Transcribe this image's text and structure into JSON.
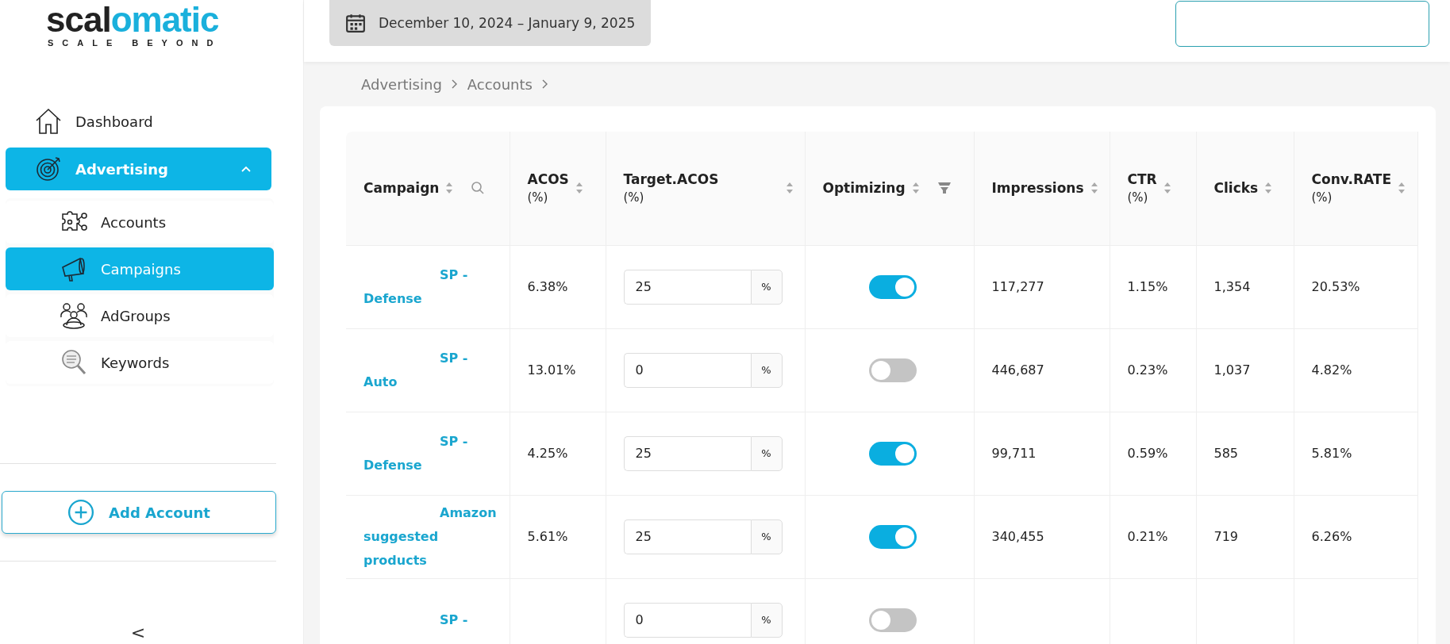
{
  "logo": {
    "dark": "scal",
    "accent": "omatic",
    "tagline": "SCALE BEYOND"
  },
  "sidebar": {
    "items": [
      {
        "label": "Dashboard",
        "selected": false
      },
      {
        "label": "Advertising",
        "selected": true,
        "expanded": true,
        "children": [
          {
            "label": "Accounts",
            "selected": false
          },
          {
            "label": "Campaigns",
            "selected": true
          },
          {
            "label": "AdGroups",
            "selected": false
          },
          {
            "label": "Keywords",
            "selected": false
          }
        ]
      }
    ],
    "add_button": "Add Account",
    "collapse": "<"
  },
  "date_range": "December 10, 2024 – January 9, 2025",
  "breadcrumb": [
    "Advertising",
    "Accounts"
  ],
  "table": {
    "columns": [
      {
        "label": "Campaign"
      },
      {
        "label": "ACOS",
        "unit": "(%)"
      },
      {
        "label": "Target.ACOS",
        "unit": "(%)"
      },
      {
        "label": "Optimizing"
      },
      {
        "label": "Impressions"
      },
      {
        "label": "CTR",
        "unit": "(%)"
      },
      {
        "label": "Clicks"
      },
      {
        "label": "Conv.RATE",
        "unit": "(%)"
      }
    ],
    "unit_suffix": "%",
    "rows": [
      {
        "campaign": "SP - Defense",
        "acos": "6.38%",
        "target": "25",
        "optimizing": true,
        "impressions": "117,277",
        "ctr": "1.15%",
        "clicks": "1,354",
        "conv": "20.53%"
      },
      {
        "campaign": "SP - Auto",
        "acos": "13.01%",
        "target": "0",
        "optimizing": false,
        "impressions": "446,687",
        "ctr": "0.23%",
        "clicks": "1,037",
        "conv": "4.82%"
      },
      {
        "campaign": "SP - Defense",
        "acos": "4.25%",
        "target": "25",
        "optimizing": true,
        "impressions": "99,711",
        "ctr": "0.59%",
        "clicks": "585",
        "conv": "5.81%"
      },
      {
        "campaign": "Amazon suggested products",
        "acos": "5.61%",
        "target": "25",
        "optimizing": true,
        "impressions": "340,455",
        "ctr": "0.21%",
        "clicks": "719",
        "conv": "6.26%"
      },
      {
        "campaign": "SP -",
        "target": "0",
        "optimizing": false
      }
    ]
  }
}
